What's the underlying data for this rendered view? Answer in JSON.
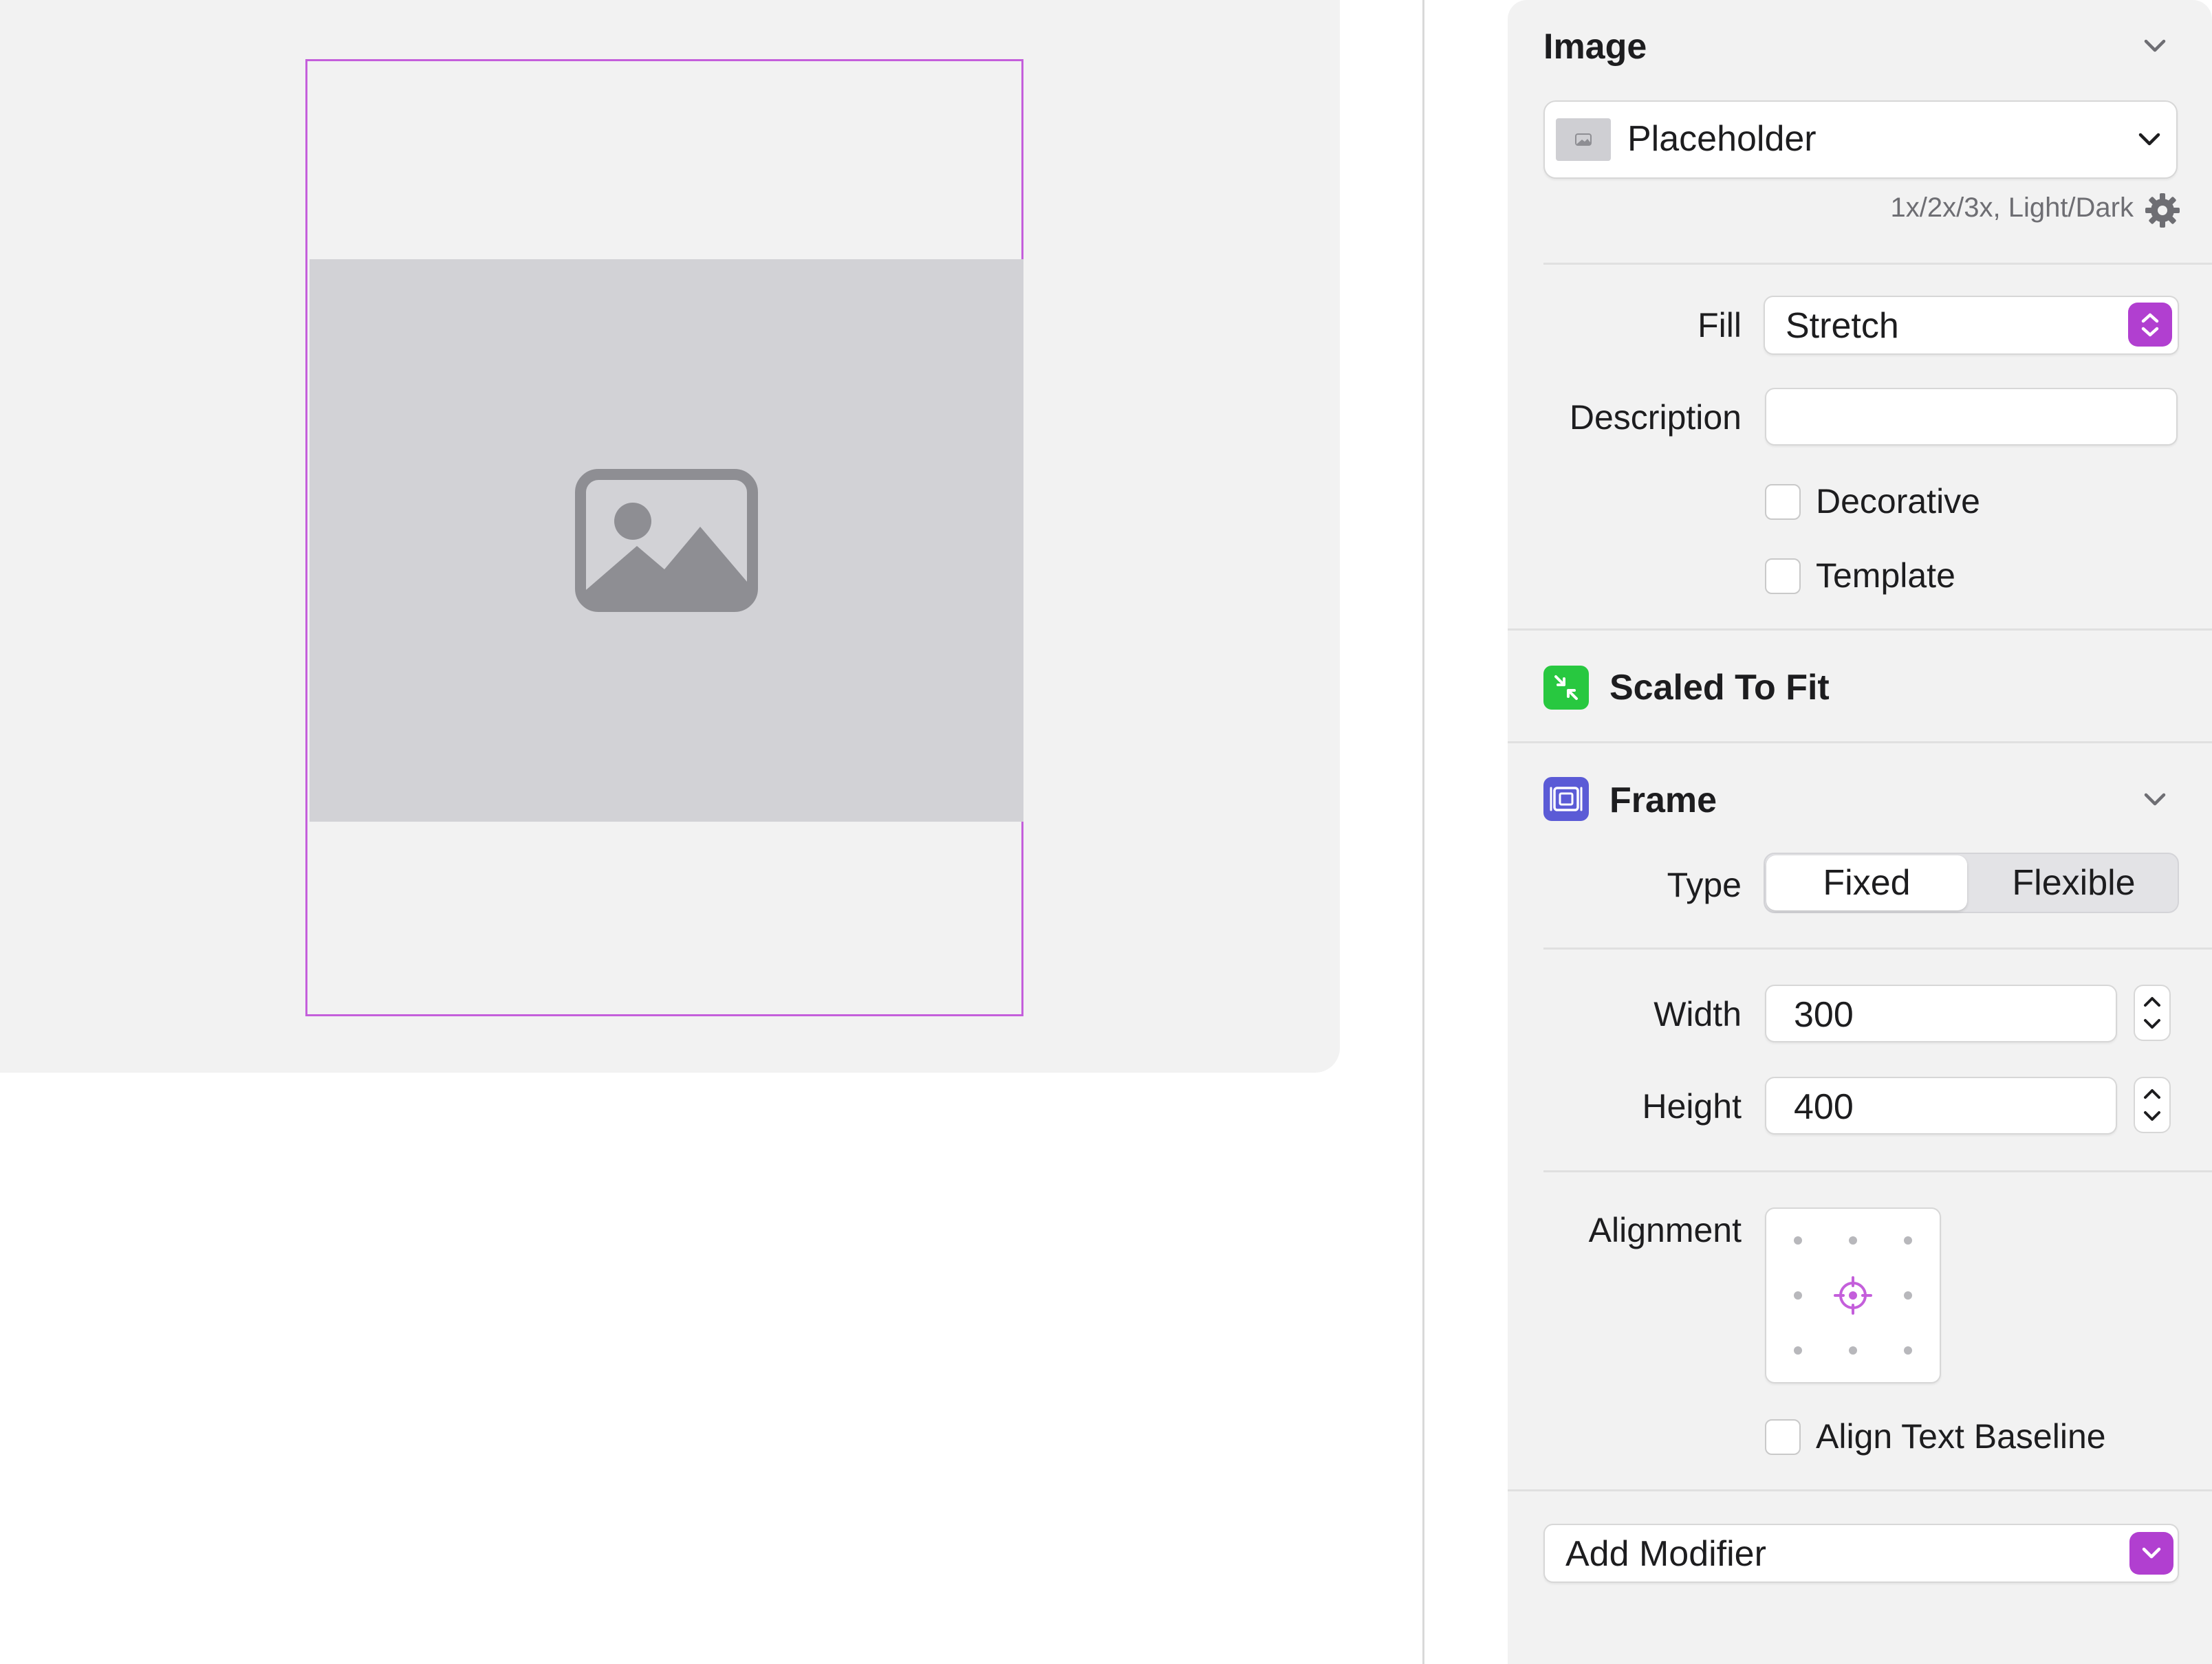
{
  "canvas": {
    "image_name": "photo-placeholder-icon"
  },
  "inspector": {
    "image_section": {
      "title": "Image",
      "source_label": "Placeholder",
      "variants_label": "1x/2x/3x, Light/Dark"
    },
    "fill": {
      "label": "Fill",
      "value": "Stretch"
    },
    "description": {
      "label": "Description",
      "value": "",
      "placeholder": ""
    },
    "decorative": {
      "label": "Decorative",
      "checked": false
    },
    "template": {
      "label": "Template",
      "checked": false
    },
    "scaled_to_fit": {
      "title": "Scaled To Fit",
      "icon_color": "#28c840"
    },
    "frame": {
      "title": "Frame",
      "icon_color": "#5b5bd6",
      "type_label": "Type",
      "type_options": [
        "Fixed",
        "Flexible"
      ],
      "type_selected": "Fixed",
      "width_label": "Width",
      "width_value": "300",
      "height_label": "Height",
      "height_value": "400",
      "alignment_label": "Alignment",
      "alignment_selected": "center",
      "align_text_baseline": {
        "label": "Align Text Baseline",
        "checked": false
      }
    },
    "add_modifier": {
      "label": "Add Modifier"
    },
    "accent_color": "#b13fd0"
  }
}
